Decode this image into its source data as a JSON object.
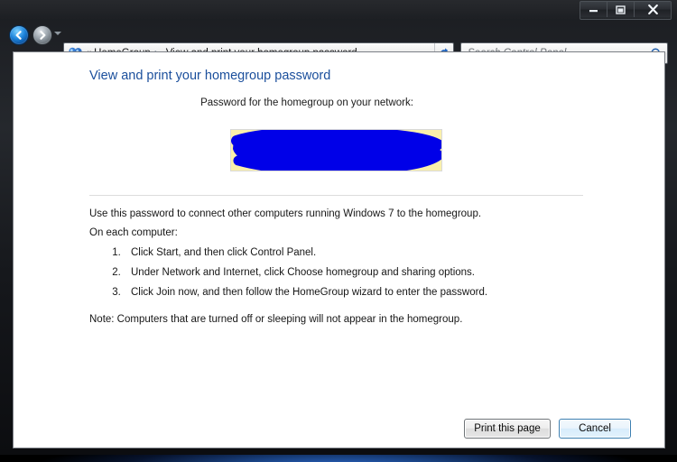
{
  "window": {
    "controls": {
      "minimize_label": "Minimize",
      "maximize_label": "Maximize",
      "close_label": "Close"
    }
  },
  "navbar": {
    "back_label": "Back",
    "forward_label": "Forward",
    "recent_pages_label": "Recent pages",
    "address": {
      "icon": "homegroup-icon",
      "leading_chevrons": "«",
      "separator": "▶",
      "crumbs": [
        "HomeGroup",
        "View and print your homegroup password"
      ],
      "dropdown_label": "Previous locations"
    },
    "refresh_label": "Refresh",
    "search": {
      "placeholder": "Search Control Panel",
      "value": "",
      "icon": "search-icon"
    }
  },
  "content": {
    "page_title": "View and print your homegroup password",
    "password_caption": "Password for the homegroup on your network:",
    "password_value": "██████████",
    "password_redacted": true,
    "intro_line": "Use this password to connect other computers running Windows 7 to the homegroup.",
    "on_each_computer": "On each computer:",
    "steps": [
      "Click Start, and then click Control Panel.",
      "Under Network and Internet, click Choose homegroup and sharing options.",
      "Click Join now, and then follow the HomeGroup wizard to enter the password."
    ],
    "note": "Note: Computers that are turned off or sleeping will not appear in the homegroup."
  },
  "footer": {
    "print_label": "Print this page",
    "cancel_label": "Cancel"
  },
  "colors": {
    "title_blue": "#1b4f9c",
    "highlight_yellow": "#faf0ab",
    "redaction_blue": "#0000e8",
    "content_background": "#ffffff",
    "frame_dark": "#1b1d21"
  }
}
